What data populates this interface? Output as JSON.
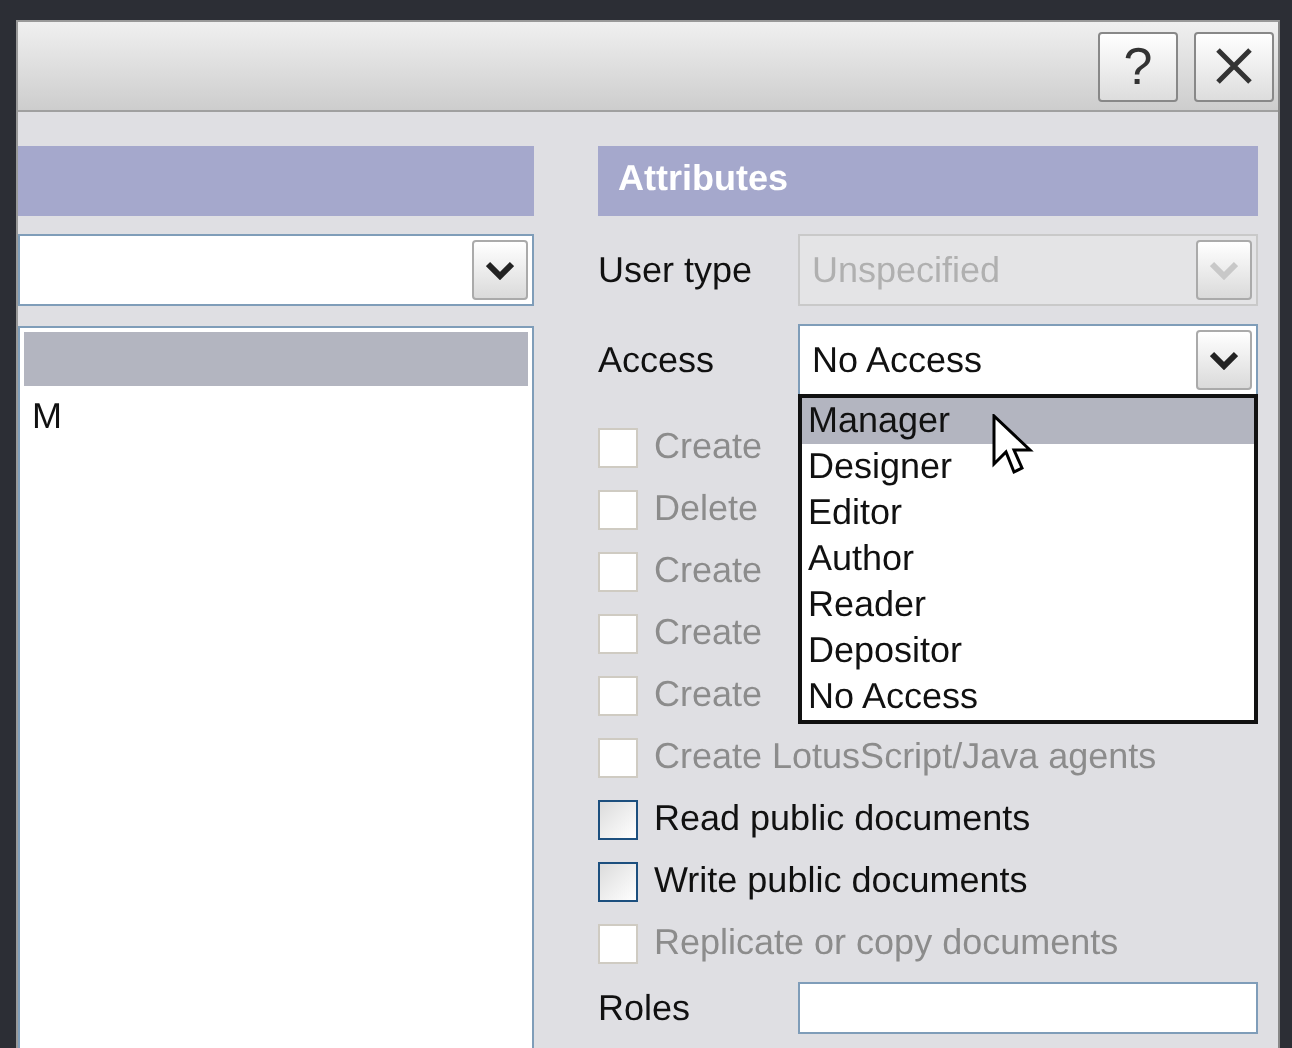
{
  "window": {
    "help": "?"
  },
  "left_panel": {
    "list": {
      "rows": [
        {
          "selected": true
        },
        {
          "label": "M",
          "selected": false
        }
      ]
    }
  },
  "attributes": {
    "title": "Attributes",
    "user_type": {
      "label": "User type",
      "value": "Unspecified",
      "disabled": true
    },
    "access": {
      "label": "Access",
      "value": "No Access",
      "expanded": true,
      "options": [
        {
          "label": "Manager",
          "highlighted": true
        },
        {
          "label": "Designer",
          "highlighted": false
        },
        {
          "label": "Editor",
          "highlighted": false
        },
        {
          "label": "Author",
          "highlighted": false
        },
        {
          "label": "Reader",
          "highlighted": false
        },
        {
          "label": "Depositor",
          "highlighted": false
        },
        {
          "label": "No Access",
          "highlighted": false
        }
      ]
    },
    "checkboxes": [
      {
        "label": "Create",
        "checked": false,
        "disabled": true
      },
      {
        "label": "Delete",
        "checked": false,
        "disabled": true
      },
      {
        "label": "Create",
        "checked": false,
        "disabled": true
      },
      {
        "label": "Create",
        "checked": false,
        "disabled": true
      },
      {
        "label": "Create",
        "checked": false,
        "disabled": true
      },
      {
        "label": "Create LotusScript/Java agents",
        "checked": false,
        "disabled": true
      },
      {
        "label": "Read public documents",
        "checked": false,
        "disabled": false
      },
      {
        "label": "Write public documents",
        "checked": false,
        "disabled": false
      },
      {
        "label": "Replicate or copy documents",
        "checked": false,
        "disabled": true
      }
    ],
    "roles": {
      "label": "Roles"
    }
  }
}
